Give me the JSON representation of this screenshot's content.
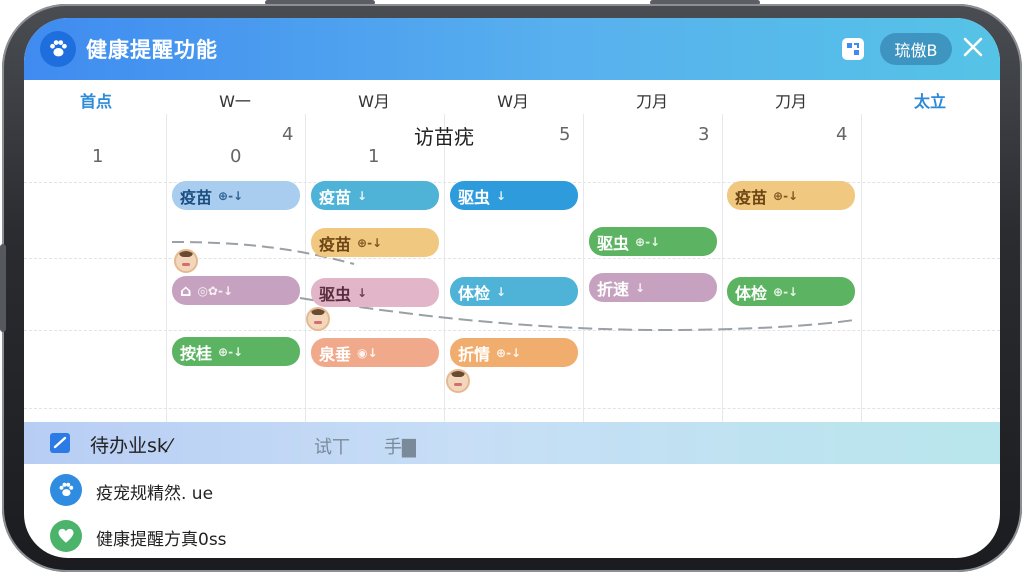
{
  "app": {
    "title": "健康提醒功能",
    "header_pill": "琉傲B",
    "accent_color": "#3f8bf0",
    "icons": [
      "paw-icon",
      "widget-icon",
      "close-icon"
    ]
  },
  "calendar": {
    "columns": [
      {
        "label": "首点"
      },
      {
        "label": "W一"
      },
      {
        "label": "W月"
      },
      {
        "label": "W月"
      },
      {
        "label": "刀月"
      },
      {
        "label": "刀月"
      },
      {
        "label": "太立"
      }
    ],
    "cell_title": "访苗疣",
    "day_numbers": {
      "c0": "1",
      "c1a": "4",
      "c1b": "0",
      "c2": "1",
      "c3": "5",
      "c4": "3",
      "c5": "4"
    },
    "events": [
      {
        "title": "疫苗",
        "meta": "⊕-↓"
      },
      {
        "title": "疫苗",
        "meta": "↓"
      },
      {
        "title": "驱虫",
        "meta": "↓"
      },
      {
        "title": "疫苗",
        "meta": "⊕-↓"
      },
      {
        "title": "疫苗",
        "meta": "⊕-↓"
      },
      {
        "title": "驱虫",
        "meta": "⊕-↓"
      },
      {
        "title": "⌂",
        "meta": "◎✿-↓"
      },
      {
        "title": "驱虫",
        "meta": "↓"
      },
      {
        "title": "体检",
        "meta": "↓"
      },
      {
        "title": "折速",
        "meta": "↓"
      },
      {
        "title": "体检",
        "meta": "⊕-↓"
      },
      {
        "title": "按桂",
        "meta": "⊕-↓"
      },
      {
        "title": "泉垂",
        "meta": "◉↓"
      },
      {
        "title": "折情",
        "meta": "⊕-↓"
      }
    ]
  },
  "todo": {
    "label": "待办业sk⁄",
    "tab2": "试丅",
    "tab3": "手▇"
  },
  "list": [
    {
      "text": "疫宠规精然. ue",
      "icon": "paw-icon",
      "color": "#2f8ce0"
    },
    {
      "text": "健康提醒方真0ss",
      "icon": "heart-icon",
      "color": "#4cb36a"
    }
  ]
}
